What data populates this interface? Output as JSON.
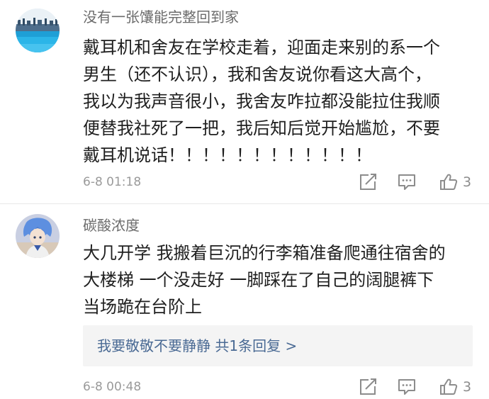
{
  "comments": [
    {
      "username": "没有一张馕能完整回到家",
      "avatar_icon": "avatar-icon-landscape",
      "lines": [
        "戴耳机和舍友在学校走着，迎面走来别的系一个",
        "男生（还不认识），我和舍友说你看这大高个，",
        "我以为我声音很小，我舍友咋拉都没能拉住我顺",
        "便替我社死了一把，我后知后觉开始尴尬，不要",
        "戴耳机说话！！！！！！！！！！！！"
      ],
      "time": "6-8 01:18",
      "likes": "3"
    },
    {
      "username": "碳酸浓度",
      "avatar_icon": "avatar-icon-anime",
      "lines": [
        "大几开学 我搬着巨沉的行李箱准备爬通往宿舍的",
        "大楼梯 一个没走好 一脚踩在了自己的阔腿裤下",
        "当场跪在台阶上"
      ],
      "reply_link": "我要敬敬不要静静  共1条回复 >",
      "time": "6-8 00:48",
      "likes": "3"
    }
  ],
  "icons": {
    "share": "share-icon",
    "comment": "comment-icon",
    "like": "thumbs-up-icon"
  },
  "colors": {
    "username": "#6b6b6b",
    "body": "#1f1f1f",
    "time": "#9a9a9a",
    "reply_link": "#4a6a94",
    "reply_bg": "#f4f4f4",
    "icon": "#8c8c8c"
  }
}
